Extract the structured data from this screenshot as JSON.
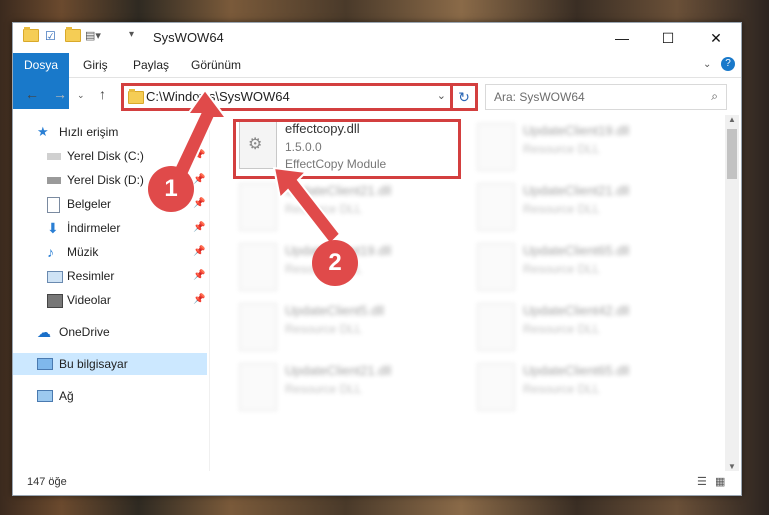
{
  "window": {
    "title": "SysWOW64",
    "controls": {
      "minimize": "—",
      "maximize": "☐",
      "close": "✕"
    }
  },
  "ribbon": {
    "tabs": [
      "Dosya",
      "Giriş",
      "Paylaş",
      "Görünüm"
    ],
    "help": "?"
  },
  "address": {
    "path": "C:\\Windows\\SysWOW64",
    "search_placeholder": "Ara: SysWOW64"
  },
  "sidebar": {
    "items": [
      {
        "label": "Hızlı erişim",
        "icon": "star-icon"
      },
      {
        "label": "Yerel Disk (C:)",
        "icon": "drive-icon"
      },
      {
        "label": "Yerel Disk (D:)",
        "icon": "drive-icon"
      },
      {
        "label": "Belgeler",
        "icon": "document-icon"
      },
      {
        "label": "İndirmeler",
        "icon": "download-icon"
      },
      {
        "label": "Müzik",
        "icon": "music-icon"
      },
      {
        "label": "Resimler",
        "icon": "picture-icon"
      },
      {
        "label": "Videolar",
        "icon": "video-icon"
      },
      {
        "label": "OneDrive",
        "icon": "cloud-icon"
      },
      {
        "label": "Bu bilgisayar",
        "icon": "computer-icon"
      },
      {
        "label": "Ağ",
        "icon": "network-icon"
      }
    ]
  },
  "files": [
    {
      "name": "effectcopy.dll",
      "version": "1.5.0.0",
      "desc": "EffectCopy Module"
    },
    {
      "name": "UpdateClient19.dll",
      "desc": "Resource DLL"
    },
    {
      "name": "UpdateClient21.dll",
      "desc": "Resource DLL"
    },
    {
      "name": "UpdateClient21.dll",
      "desc": "Resource DLL"
    },
    {
      "name": "UpdateClient19.dll",
      "desc": "Resource DLL"
    },
    {
      "name": "UpdateClient65.dll",
      "desc": "Resource DLL"
    },
    {
      "name": "UpdateClient5.dll",
      "desc": "Resource DLL"
    },
    {
      "name": "UpdateClient42.dll",
      "desc": "Resource DLL"
    },
    {
      "name": "UpdateClient21.dll",
      "desc": "Resource DLL"
    },
    {
      "name": "UpdateClient65.dll",
      "desc": "Resource DLL"
    }
  ],
  "status": {
    "count": "147 öğe"
  },
  "annotations": {
    "step1": "1",
    "step2": "2"
  },
  "colors": {
    "accent": "#1979ca",
    "highlight": "#d33f3f"
  }
}
